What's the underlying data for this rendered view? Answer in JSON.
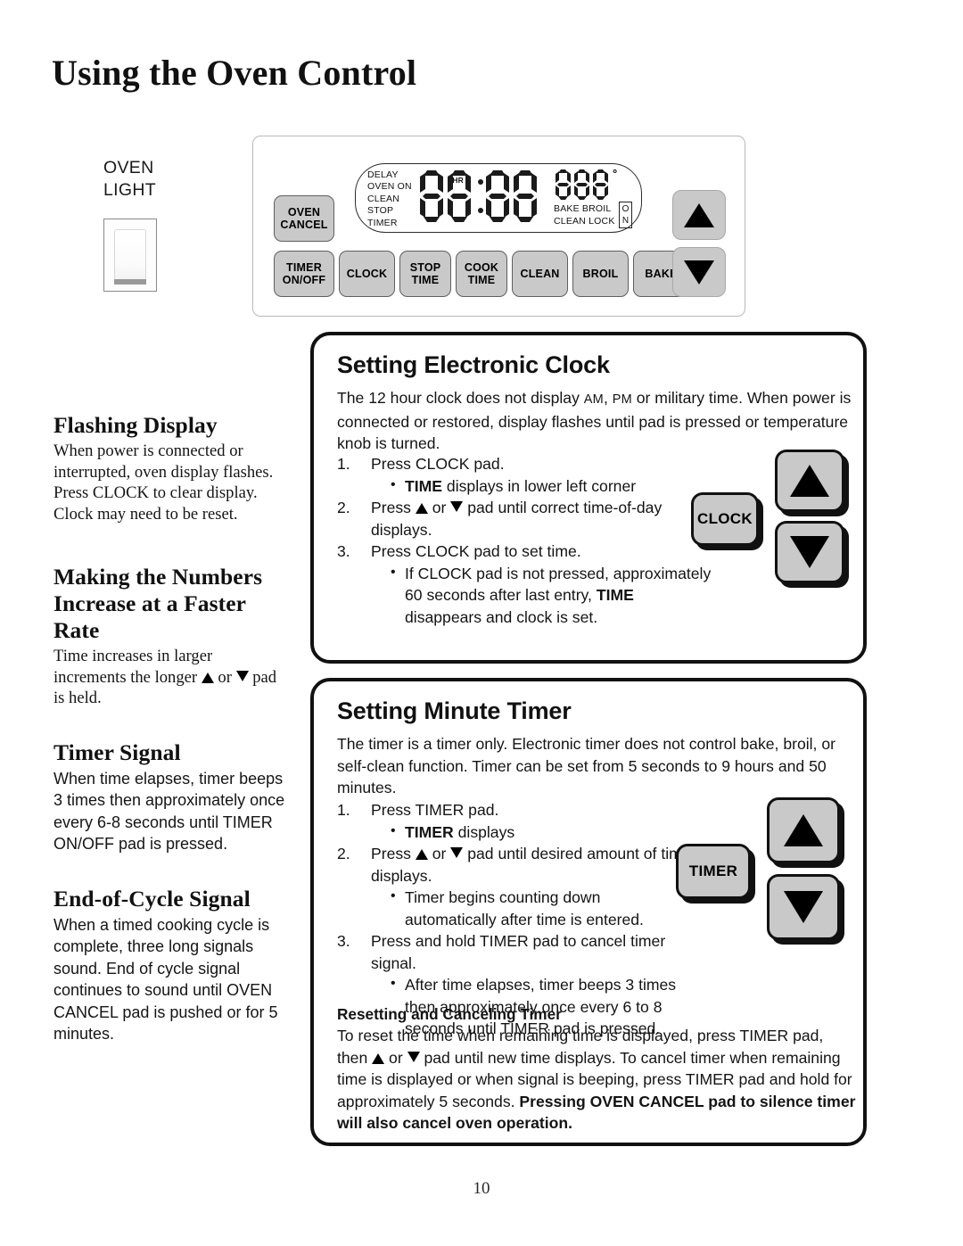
{
  "page": {
    "title": "Using the Oven Control",
    "number": "10"
  },
  "oven_light": {
    "line1": "OVEN",
    "line2": "LIGHT"
  },
  "control_panel": {
    "display": {
      "indicators": [
        "DELAY",
        "OVEN ON",
        "CLEAN",
        "STOP",
        "TIMER"
      ],
      "hr_label": "HR",
      "clock_digits": "88:88",
      "temp_digits": "888",
      "degree_symbol": "°",
      "mode_row1": "BAKE  BROIL",
      "mode_row2": "CLEAN LOCK",
      "on_box": [
        "O",
        "N"
      ]
    },
    "pads": {
      "oven_cancel": [
        "OVEN",
        "CANCEL"
      ],
      "timer_on_off": [
        "TIMER",
        "ON/OFF"
      ],
      "clock": "CLOCK",
      "stop_time": [
        "STOP",
        "TIME"
      ],
      "cook_time": [
        "COOK",
        "TIME"
      ],
      "clean": "CLEAN",
      "broil": "BROIL",
      "bake": "BAKE",
      "up_arrow": "▲",
      "down_arrow": "▼"
    }
  },
  "left_column": {
    "flashing_display": {
      "heading": "Flashing Display",
      "body": "When power is connected or interrupted, oven display flashes. Press CLOCK to clear display. Clock may need to be reset."
    },
    "faster_rate": {
      "heading_line1": "Making the Numbers",
      "heading_line2": "Increase at a Faster",
      "heading_line3": "Rate",
      "body_pre": "Time increases in larger increments the longer",
      "body_mid": "or",
      "body_post": "pad is held."
    },
    "timer_signal": {
      "heading": "Timer Signal",
      "body": "When time elapses, timer beeps 3 times then approximately once every 6-8 seconds until TIMER ON/OFF pad is pressed."
    },
    "end_of_cycle": {
      "heading": "End-of-Cycle Signal",
      "body": "When a timed cooking cycle is complete, three long signals sound.  End of cycle signal continues to sound until OVEN CANCEL pad is pushed or for 5 minutes."
    }
  },
  "clock_panel": {
    "title": "Setting Electronic Clock",
    "intro_a": "The 12 hour clock does not display ",
    "intro_am": "AM",
    "intro_b": ", ",
    "intro_pm": "PM",
    "intro_c": " or military time. When power is connected or restored, display flashes until pad is pressed or temperature knob is turned.",
    "steps": [
      {
        "num": "1.",
        "text": "Press CLOCK pad.",
        "subs_pre": "",
        "sub_bold": "TIME",
        "sub_text": " displays in lower left corner"
      },
      {
        "num": "2.",
        "text_pre": "Press",
        "text_mid": "or",
        "text_post": "pad until correct time-of-day displays."
      },
      {
        "num": "3.",
        "text": "Press CLOCK pad to set time.",
        "sub_pre": "If CLOCK pad is not pressed, approximately 60 seconds after last entry, ",
        "sub_bold": "TIME",
        "sub_post": " disappears and clock is set."
      }
    ],
    "pad_label": "CLOCK",
    "up_arrow": "▲",
    "down_arrow": "▼"
  },
  "timer_panel": {
    "title": "Setting Minute Timer",
    "intro": "The timer is a timer only. Electronic timer does not control bake, broil, or self-clean function. Timer can be set from 5 seconds to 9 hours and 50 minutes.",
    "steps": [
      {
        "num": "1.",
        "text": "Press TIMER pad.",
        "sub_bold": "TIMER",
        "sub_text": " displays"
      },
      {
        "num": "2.",
        "text_pre": "Press",
        "text_mid": "or",
        "text_post": "pad until desired amount of time displays.",
        "sub_text": "Timer begins counting down automatically after time is entered."
      },
      {
        "num": "3.",
        "text": "Press and hold TIMER pad to cancel timer signal.",
        "sub_text": "After time elapses, timer beeps 3 times then approximately once every 6 to 8 seconds until TIMER pad is pressed."
      }
    ],
    "note": {
      "title": "Resetting and Canceling Timer",
      "text_a": "To reset the time when remaining time is displayed, press TIMER  pad, then ",
      "text_mid": " or ",
      "text_b": " pad until new time displays. To cancel timer when remaining time is displayed or when signal is beeping, press TIMER pad and hold for approximately 5 seconds. ",
      "text_bold": "Pressing OVEN CANCEL pad to silence timer will also cancel oven operation."
    },
    "pad_label": "TIMER",
    "up_arrow": "▲",
    "down_arrow": "▼"
  }
}
